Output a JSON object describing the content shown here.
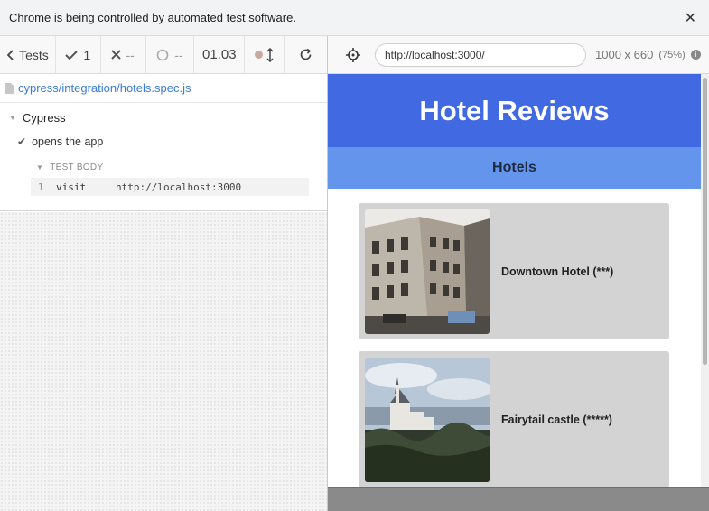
{
  "infobar": {
    "message": "Chrome is being controlled by automated test software.",
    "close_icon": "close-icon"
  },
  "reporter": {
    "toolbar": {
      "tests_label": "Tests",
      "passed_count": "1",
      "failed_count": "--",
      "pending_count": "--",
      "duration": "01.03"
    },
    "spec_file": "cypress/integration/hotels.spec.js",
    "suite": {
      "title": "Cypress",
      "test_title": "opens the app",
      "body_label": "TEST BODY",
      "commands": [
        {
          "number": "1",
          "name": "visit",
          "message": "http://localhost:3000"
        }
      ]
    }
  },
  "aut": {
    "url": "http://localhost:3000/",
    "viewport": "1000 x 660",
    "scale": "(75%)",
    "page": {
      "title": "Hotel Reviews",
      "subtitle": "Hotels",
      "hotels": [
        {
          "name": "Downtown Hotel (***)"
        },
        {
          "name": "Fairytail castle (*****)"
        }
      ]
    }
  },
  "colors": {
    "header_blue": "#4169e1",
    "subheader_blue": "#6495ed",
    "card_gray": "#d3d3d3",
    "link_blue": "#3a7bd5"
  }
}
